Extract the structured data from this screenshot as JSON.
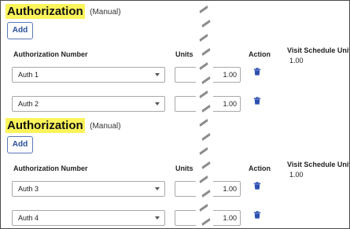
{
  "sections": [
    {
      "title": "Authorization",
      "title_note": "(Manual)",
      "add_label": "Add",
      "headers": {
        "authorization_number": "Authorization Number",
        "units": "Units",
        "action": "Action",
        "visit_schedule_units": "Visit Schedule Units"
      },
      "visit_schedule_units_value": "1.00",
      "rows": [
        {
          "authorization": "Auth 1",
          "units": "1.00"
        },
        {
          "authorization": "Auth 2",
          "units": "1.00"
        }
      ]
    },
    {
      "title": "Authorization",
      "title_note": "(Manual)",
      "add_label": "Add",
      "headers": {
        "authorization_number": "Authorization Number",
        "units": "Units",
        "action": "Action",
        "visit_schedule_units": "Visit Schedule Units"
      },
      "visit_schedule_units_value": "1.00",
      "rows": [
        {
          "authorization": "Auth 3",
          "units": "1.00"
        },
        {
          "authorization": "Auth 4",
          "units": "1.00"
        }
      ]
    }
  ],
  "colors": {
    "title_highlight": "#fbf45a",
    "button_border": "#5a78b8",
    "button_text": "#2a4f9c",
    "trash_icon": "#2b4fb0",
    "tear_line": "#8c8c8c"
  },
  "icons": {
    "delete": "trash-icon",
    "dropdown": "chevron-down-icon"
  }
}
